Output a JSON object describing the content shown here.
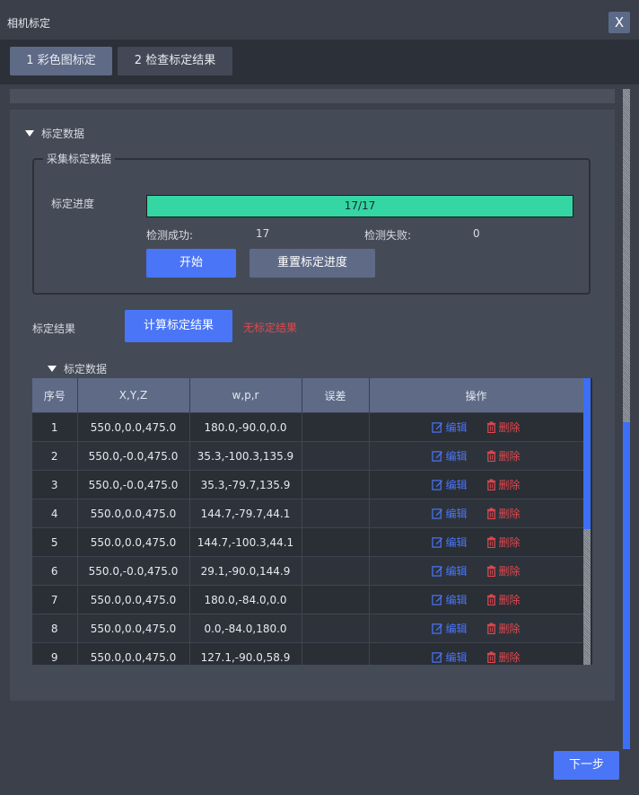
{
  "window": {
    "title": "相机标定",
    "close_label": "X"
  },
  "tabs": [
    {
      "label": "1 彩色图标定",
      "active": true
    },
    {
      "label": "2 检查标定结果",
      "active": false
    }
  ],
  "section_title": "标定数据",
  "collect": {
    "legend": "采集标定数据",
    "progress_label": "标定进度",
    "progress_text": "17/17",
    "progress_fraction": 1.0,
    "success_label": "检测成功:",
    "success_value": "17",
    "fail_label": "检测失败:",
    "fail_value": "0",
    "start_button": "开始",
    "reset_button": "重置标定进度"
  },
  "result": {
    "label": "标定结果",
    "compute_button": "计算标定结果",
    "status": "无标定结果"
  },
  "table": {
    "title": "标定数据",
    "columns": [
      "序号",
      "X,Y,Z",
      "w,p,r",
      "误差",
      "操作"
    ],
    "edit_label": "编辑",
    "delete_label": "删除",
    "rows": [
      {
        "index": "1",
        "xyz": "550.0,0.0,475.0",
        "wpr": "180.0,-90.0,0.0",
        "error": ""
      },
      {
        "index": "2",
        "xyz": "550.0,-0.0,475.0",
        "wpr": "35.3,-100.3,135.9",
        "error": ""
      },
      {
        "index": "3",
        "xyz": "550.0,-0.0,475.0",
        "wpr": "35.3,-79.7,135.9",
        "error": ""
      },
      {
        "index": "4",
        "xyz": "550.0,0.0,475.0",
        "wpr": "144.7,-79.7,44.1",
        "error": ""
      },
      {
        "index": "5",
        "xyz": "550.0,0.0,475.0",
        "wpr": "144.7,-100.3,44.1",
        "error": ""
      },
      {
        "index": "6",
        "xyz": "550.0,-0.0,475.0",
        "wpr": "29.1,-90.0,144.9",
        "error": ""
      },
      {
        "index": "7",
        "xyz": "550.0,0.0,475.0",
        "wpr": "180.0,-84.0,0.0",
        "error": ""
      },
      {
        "index": "8",
        "xyz": "550.0,0.0,475.0",
        "wpr": "0.0,-84.0,180.0",
        "error": ""
      },
      {
        "index": "9",
        "xyz": "550.0,0.0,475.0",
        "wpr": "127.1,-90.0,58.9",
        "error": ""
      }
    ]
  },
  "footer": {
    "next_button": "下一步"
  },
  "colors": {
    "accent": "#4a75f7",
    "progress": "#34d6a3",
    "danger": "#e0484f"
  }
}
